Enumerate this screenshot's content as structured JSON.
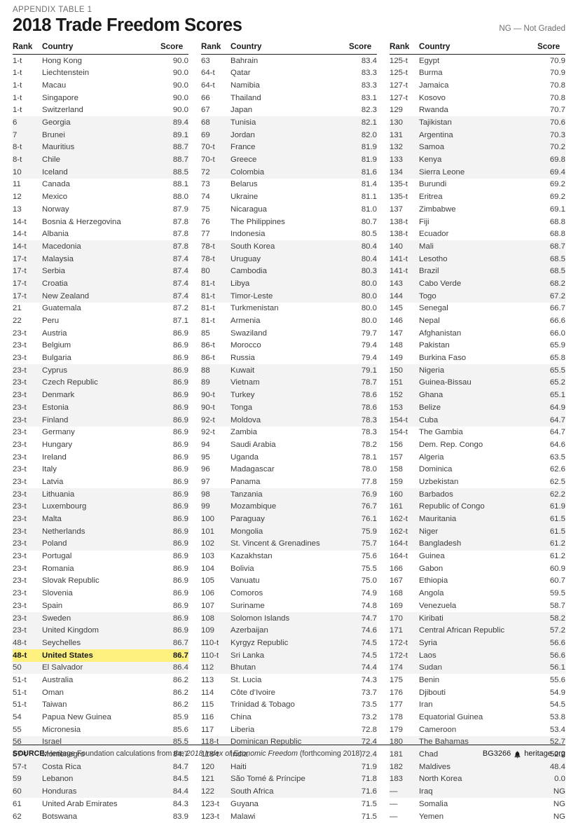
{
  "header": {
    "kicker": "APPENDIX TABLE 1",
    "title": "2018 Trade Freedom Scores",
    "legend_note": "NG — Not Graded"
  },
  "table": {
    "columns": {
      "rank": "Rank",
      "country": "Country",
      "score": "Score"
    },
    "highlight_country": "United States",
    "highlight_color": "#fdf07f",
    "shade_color": "#f2f3f2",
    "col1": [
      {
        "rank": "1-t",
        "country": "Hong Kong",
        "score": "90.0"
      },
      {
        "rank": "1-t",
        "country": "Liechtenstein",
        "score": "90.0"
      },
      {
        "rank": "1-t",
        "country": "Macau",
        "score": "90.0"
      },
      {
        "rank": "1-t",
        "country": "Singapore",
        "score": "90.0"
      },
      {
        "rank": "1-t",
        "country": "Switzerland",
        "score": "90.0"
      },
      {
        "rank": "6",
        "country": "Georgia",
        "score": "89.4"
      },
      {
        "rank": "7",
        "country": "Brunei",
        "score": "89.1"
      },
      {
        "rank": "8-t",
        "country": "Mauritius",
        "score": "88.7"
      },
      {
        "rank": "8-t",
        "country": "Chile",
        "score": "88.7"
      },
      {
        "rank": "10",
        "country": "Iceland",
        "score": "88.5"
      },
      {
        "rank": "11",
        "country": "Canada",
        "score": "88.1"
      },
      {
        "rank": "12",
        "country": "Mexico",
        "score": "88.0"
      },
      {
        "rank": "13",
        "country": "Norway",
        "score": "87.9"
      },
      {
        "rank": "14-t",
        "country": "Bosnia & Herzegovina",
        "score": "87.8"
      },
      {
        "rank": "14-t",
        "country": "Albania",
        "score": "87.8"
      },
      {
        "rank": "14-t",
        "country": "Macedonia",
        "score": "87.8"
      },
      {
        "rank": "17-t",
        "country": "Malaysia",
        "score": "87.4"
      },
      {
        "rank": "17-t",
        "country": "Serbia",
        "score": "87.4"
      },
      {
        "rank": "17-t",
        "country": "Croatia",
        "score": "87.4"
      },
      {
        "rank": "17-t",
        "country": "New Zealand",
        "score": "87.4"
      },
      {
        "rank": "21",
        "country": "Guatemala",
        "score": "87.2"
      },
      {
        "rank": "22",
        "country": "Peru",
        "score": "87.1"
      },
      {
        "rank": "23-t",
        "country": "Austria",
        "score": "86.9"
      },
      {
        "rank": "23-t",
        "country": "Belgium",
        "score": "86.9"
      },
      {
        "rank": "23-t",
        "country": "Bulgaria",
        "score": "86.9"
      },
      {
        "rank": "23-t",
        "country": "Cyprus",
        "score": "86.9"
      },
      {
        "rank": "23-t",
        "country": "Czech Republic",
        "score": "86.9"
      },
      {
        "rank": "23-t",
        "country": "Denmark",
        "score": "86.9"
      },
      {
        "rank": "23-t",
        "country": "Estonia",
        "score": "86.9"
      },
      {
        "rank": "23-t",
        "country": "Finland",
        "score": "86.9"
      },
      {
        "rank": "23-t",
        "country": "Germany",
        "score": "86.9"
      },
      {
        "rank": "23-t",
        "country": "Hungary",
        "score": "86.9"
      },
      {
        "rank": "23-t",
        "country": "Ireland",
        "score": "86.9"
      },
      {
        "rank": "23-t",
        "country": "Italy",
        "score": "86.9"
      },
      {
        "rank": "23-t",
        "country": "Latvia",
        "score": "86.9"
      },
      {
        "rank": "23-t",
        "country": "Lithuania",
        "score": "86.9"
      },
      {
        "rank": "23-t",
        "country": "Luxembourg",
        "score": "86.9"
      },
      {
        "rank": "23-t",
        "country": "Malta",
        "score": "86.9"
      },
      {
        "rank": "23-t",
        "country": "Netherlands",
        "score": "86.9"
      },
      {
        "rank": "23-t",
        "country": "Poland",
        "score": "86.9"
      },
      {
        "rank": "23-t",
        "country": "Portugal",
        "score": "86.9"
      },
      {
        "rank": "23-t",
        "country": "Romania",
        "score": "86.9"
      },
      {
        "rank": "23-t",
        "country": "Slovak Republic",
        "score": "86.9"
      },
      {
        "rank": "23-t",
        "country": "Slovenia",
        "score": "86.9"
      },
      {
        "rank": "23-t",
        "country": "Spain",
        "score": "86.9"
      },
      {
        "rank": "23-t",
        "country": "Sweden",
        "score": "86.9"
      },
      {
        "rank": "23-t",
        "country": "United Kingdom",
        "score": "86.9"
      },
      {
        "rank": "48-t",
        "country": "Seychelles",
        "score": "86.7"
      },
      {
        "rank": "48-t",
        "country": "United States",
        "score": "86.7"
      },
      {
        "rank": "50",
        "country": "El Salvador",
        "score": "86.4"
      },
      {
        "rank": "51-t",
        "country": "Australia",
        "score": "86.2"
      },
      {
        "rank": "51-t",
        "country": "Oman",
        "score": "86.2"
      },
      {
        "rank": "51-t",
        "country": "Taiwan",
        "score": "86.2"
      },
      {
        "rank": "54",
        "country": "Papua New Guinea",
        "score": "85.9"
      },
      {
        "rank": "55",
        "country": "Micronesia",
        "score": "85.6"
      },
      {
        "rank": "56",
        "country": "Israel",
        "score": "85.5"
      },
      {
        "rank": "57-t",
        "country": "Montenegro",
        "score": "84.7"
      },
      {
        "rank": "57-t",
        "country": "Costa Rica",
        "score": "84.7"
      },
      {
        "rank": "59",
        "country": "Lebanon",
        "score": "84.5"
      },
      {
        "rank": "60",
        "country": "Honduras",
        "score": "84.4"
      },
      {
        "rank": "61",
        "country": "United Arab Emirates",
        "score": "84.3"
      },
      {
        "rank": "62",
        "country": "Botswana",
        "score": "83.9"
      }
    ],
    "col2": [
      {
        "rank": "63",
        "country": "Bahrain",
        "score": "83.4"
      },
      {
        "rank": "64-t",
        "country": "Qatar",
        "score": "83.3"
      },
      {
        "rank": "64-t",
        "country": "Namibia",
        "score": "83.3"
      },
      {
        "rank": "66",
        "country": "Thailand",
        "score": "83.1"
      },
      {
        "rank": "67",
        "country": "Japan",
        "score": "82.3"
      },
      {
        "rank": "68",
        "country": "Tunisia",
        "score": "82.1"
      },
      {
        "rank": "69",
        "country": "Jordan",
        "score": "82.0"
      },
      {
        "rank": "70-t",
        "country": "France",
        "score": "81.9"
      },
      {
        "rank": "70-t",
        "country": "Greece",
        "score": "81.9"
      },
      {
        "rank": "72",
        "country": "Colombia",
        "score": "81.6"
      },
      {
        "rank": "73",
        "country": "Belarus",
        "score": "81.4"
      },
      {
        "rank": "74",
        "country": "Ukraine",
        "score": "81.1"
      },
      {
        "rank": "75",
        "country": "Nicaragua",
        "score": "81.0"
      },
      {
        "rank": "76",
        "country": "The Philippines",
        "score": "80.7"
      },
      {
        "rank": "77",
        "country": "Indonesia",
        "score": "80.5"
      },
      {
        "rank": "78-t",
        "country": "South Korea",
        "score": "80.4"
      },
      {
        "rank": "78-t",
        "country": "Uruguay",
        "score": "80.4"
      },
      {
        "rank": "80",
        "country": "Cambodia",
        "score": "80.3"
      },
      {
        "rank": "81-t",
        "country": "Libya",
        "score": "80.0"
      },
      {
        "rank": "81-t",
        "country": "Timor-Leste",
        "score": "80.0"
      },
      {
        "rank": "81-t",
        "country": "Turkmenistan",
        "score": "80.0"
      },
      {
        "rank": "81-t",
        "country": "Armenia",
        "score": "80.0"
      },
      {
        "rank": "85",
        "country": "Swaziland",
        "score": "79.7"
      },
      {
        "rank": "86-t",
        "country": "Morocco",
        "score": "79.4"
      },
      {
        "rank": "86-t",
        "country": "Russia",
        "score": "79.4"
      },
      {
        "rank": "88",
        "country": "Kuwait",
        "score": "79.1"
      },
      {
        "rank": "89",
        "country": "Vietnam",
        "score": "78.7"
      },
      {
        "rank": "90-t",
        "country": "Turkey",
        "score": "78.6"
      },
      {
        "rank": "90-t",
        "country": "Tonga",
        "score": "78.6"
      },
      {
        "rank": "92-t",
        "country": "Moldova",
        "score": "78.3"
      },
      {
        "rank": "92-t",
        "country": "Zambia",
        "score": "78.3"
      },
      {
        "rank": "94",
        "country": "Saudi Arabia",
        "score": "78.2"
      },
      {
        "rank": "95",
        "country": "Uganda",
        "score": "78.1"
      },
      {
        "rank": "96",
        "country": "Madagascar",
        "score": "78.0"
      },
      {
        "rank": "97",
        "country": "Panama",
        "score": "77.8"
      },
      {
        "rank": "98",
        "country": "Tanzania",
        "score": "76.9"
      },
      {
        "rank": "99",
        "country": "Mozambique",
        "score": "76.7"
      },
      {
        "rank": "100",
        "country": "Paraguay",
        "score": "76.1"
      },
      {
        "rank": "101",
        "country": "Mongolia",
        "score": "75.9"
      },
      {
        "rank": "102",
        "country": "St. Vincent & Grenadines",
        "score": "75.7"
      },
      {
        "rank": "103",
        "country": "Kazakhstan",
        "score": "75.6"
      },
      {
        "rank": "104",
        "country": "Bolivia",
        "score": "75.5"
      },
      {
        "rank": "105",
        "country": "Vanuatu",
        "score": "75.0"
      },
      {
        "rank": "106",
        "country": "Comoros",
        "score": "74.9"
      },
      {
        "rank": "107",
        "country": "Suriname",
        "score": "74.8"
      },
      {
        "rank": "108",
        "country": "Solomon Islands",
        "score": "74.7"
      },
      {
        "rank": "109",
        "country": "Azerbaijan",
        "score": "74.6"
      },
      {
        "rank": "110-t",
        "country": "Kyrgyz Republic",
        "score": "74.5"
      },
      {
        "rank": "110-t",
        "country": "Sri Lanka",
        "score": "74.5"
      },
      {
        "rank": "112",
        "country": "Bhutan",
        "score": "74.4"
      },
      {
        "rank": "113",
        "country": "St. Lucia",
        "score": "74.3"
      },
      {
        "rank": "114",
        "country": "Côte d’Ivoire",
        "score": "73.7"
      },
      {
        "rank": "115",
        "country": "Trinidad & Tobago",
        "score": "73.5"
      },
      {
        "rank": "116",
        "country": "China",
        "score": "73.2"
      },
      {
        "rank": "117",
        "country": "Liberia",
        "score": "72.8"
      },
      {
        "rank": "118-t",
        "country": "Dominican Republic",
        "score": "72.4"
      },
      {
        "rank": "118-t",
        "country": "India",
        "score": "72.4"
      },
      {
        "rank": "120",
        "country": "Haiti",
        "score": "71.9"
      },
      {
        "rank": "121",
        "country": "São Tomé & Príncipe",
        "score": "71.8"
      },
      {
        "rank": "122",
        "country": "South Africa",
        "score": "71.6"
      },
      {
        "rank": "123-t",
        "country": "Guyana",
        "score": "71.5"
      },
      {
        "rank": "123-t",
        "country": "Malawi",
        "score": "71.5"
      }
    ],
    "col3": [
      {
        "rank": "125-t",
        "country": "Egypt",
        "score": "70.9"
      },
      {
        "rank": "125-t",
        "country": "Burma",
        "score": "70.9"
      },
      {
        "rank": "127-t",
        "country": "Jamaica",
        "score": "70.8"
      },
      {
        "rank": "127-t",
        "country": "Kosovo",
        "score": "70.8"
      },
      {
        "rank": "129",
        "country": "Rwanda",
        "score": "70.7"
      },
      {
        "rank": "130",
        "country": "Tajikistan",
        "score": "70.6"
      },
      {
        "rank": "131",
        "country": "Argentina",
        "score": "70.3"
      },
      {
        "rank": "132",
        "country": "Samoa",
        "score": "70.2"
      },
      {
        "rank": "133",
        "country": "Kenya",
        "score": "69.8"
      },
      {
        "rank": "134",
        "country": "Sierra Leone",
        "score": "69.4"
      },
      {
        "rank": "135-t",
        "country": "Burundi",
        "score": "69.2"
      },
      {
        "rank": "135-t",
        "country": "Eritrea",
        "score": "69.2"
      },
      {
        "rank": "137",
        "country": "Zimbabwe",
        "score": "69.1"
      },
      {
        "rank": "138-t",
        "country": "Fiji",
        "score": "68.8"
      },
      {
        "rank": "138-t",
        "country": "Ecuador",
        "score": "68.8"
      },
      {
        "rank": "140",
        "country": "Mali",
        "score": "68.7"
      },
      {
        "rank": "141-t",
        "country": "Lesotho",
        "score": "68.5"
      },
      {
        "rank": "141-t",
        "country": "Brazil",
        "score": "68.5"
      },
      {
        "rank": "143",
        "country": "Cabo Verde",
        "score": "68.2"
      },
      {
        "rank": "144",
        "country": "Togo",
        "score": "67.2"
      },
      {
        "rank": "145",
        "country": "Senegal",
        "score": "66.7"
      },
      {
        "rank": "146",
        "country": "Nepal",
        "score": "66.6"
      },
      {
        "rank": "147",
        "country": "Afghanistan",
        "score": "66.0"
      },
      {
        "rank": "148",
        "country": "Pakistan",
        "score": "65.9"
      },
      {
        "rank": "149",
        "country": "Burkina Faso",
        "score": "65.8"
      },
      {
        "rank": "150",
        "country": "Nigeria",
        "score": "65.5"
      },
      {
        "rank": "151",
        "country": "Guinea-Bissau",
        "score": "65.2"
      },
      {
        "rank": "152",
        "country": "Ghana",
        "score": "65.1"
      },
      {
        "rank": "153",
        "country": "Belize",
        "score": "64.9"
      },
      {
        "rank": "154-t",
        "country": "Cuba",
        "score": "64.7"
      },
      {
        "rank": "154-t",
        "country": "The Gambia",
        "score": "64.7"
      },
      {
        "rank": "156",
        "country": "Dem. Rep. Congo",
        "score": "64.6"
      },
      {
        "rank": "157",
        "country": "Algeria",
        "score": "63.5"
      },
      {
        "rank": "158",
        "country": "Dominica",
        "score": "62.6"
      },
      {
        "rank": "159",
        "country": "Uzbekistan",
        "score": "62.5"
      },
      {
        "rank": "160",
        "country": "Barbados",
        "score": "62.2"
      },
      {
        "rank": "161",
        "country": "Republic of Congo",
        "score": "61.9"
      },
      {
        "rank": "162-t",
        "country": "Mauritania",
        "score": "61.5"
      },
      {
        "rank": "162-t",
        "country": "Niger",
        "score": "61.5"
      },
      {
        "rank": "164-t",
        "country": "Bangladesh",
        "score": "61.2"
      },
      {
        "rank": "164-t",
        "country": "Guinea",
        "score": "61.2"
      },
      {
        "rank": "166",
        "country": "Gabon",
        "score": "60.9"
      },
      {
        "rank": "167",
        "country": "Ethiopia",
        "score": "60.7"
      },
      {
        "rank": "168",
        "country": "Angola",
        "score": "59.5"
      },
      {
        "rank": "169",
        "country": "Venezuela",
        "score": "58.7"
      },
      {
        "rank": "170",
        "country": "Kiribati",
        "score": "58.2"
      },
      {
        "rank": "171",
        "country": "Central African Republic",
        "score": "57.2"
      },
      {
        "rank": "172-t",
        "country": "Syria",
        "score": "56.6"
      },
      {
        "rank": "172-t",
        "country": "Laos",
        "score": "56.6"
      },
      {
        "rank": "174",
        "country": "Sudan",
        "score": "56.1"
      },
      {
        "rank": "175",
        "country": "Benin",
        "score": "55.6"
      },
      {
        "rank": "176",
        "country": "Djibouti",
        "score": "54.9"
      },
      {
        "rank": "177",
        "country": "Iran",
        "score": "54.5"
      },
      {
        "rank": "178",
        "country": "Equatorial Guinea",
        "score": "53.8"
      },
      {
        "rank": "179",
        "country": "Cameroon",
        "score": "53.4"
      },
      {
        "rank": "180",
        "country": "The Bahamas",
        "score": "52.7"
      },
      {
        "rank": "181",
        "country": "Chad",
        "score": "52.2"
      },
      {
        "rank": "182",
        "country": "Maldives",
        "score": "48.4"
      },
      {
        "rank": "183",
        "country": "North Korea",
        "score": "0.0"
      },
      {
        "rank": "—",
        "country": "Iraq",
        "score": "NG"
      },
      {
        "rank": "—",
        "country": "Somalia",
        "score": "NG"
      },
      {
        "rank": "—",
        "country": "Yemen",
        "score": "NG"
      }
    ]
  },
  "footer": {
    "source_label": "SOURCE:",
    "source_text_1": "Heritage Foundation calculations from the ",
    "source_italic": "2018 Index of Economic Freedom",
    "source_text_2": " (forthcoming 2018).",
    "report_id": "BG3266",
    "site": "heritage.org"
  }
}
